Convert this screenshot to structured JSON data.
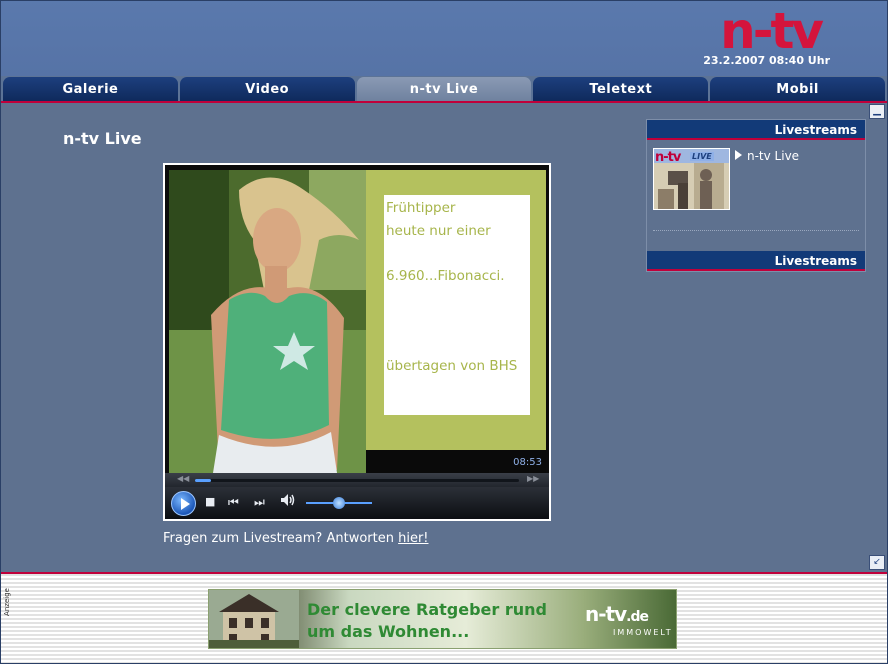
{
  "header": {
    "logo_text": "n-tv",
    "datetime": "23.2.2007 08:40 Uhr"
  },
  "tabs": [
    {
      "label": "Galerie",
      "active": false
    },
    {
      "label": "Video",
      "active": false
    },
    {
      "label": "n-tv Live",
      "active": true
    },
    {
      "label": "Teletext",
      "active": false
    },
    {
      "label": "Mobil",
      "active": false
    }
  ],
  "main": {
    "title": "n-tv Live",
    "video_card_lines": [
      "Frühtipper",
      "heute nur einer",
      "",
      "6.960...Fibonacci.",
      "",
      "",
      "",
      "übertagen von BHS"
    ],
    "player": {
      "time": "08:53",
      "seek_progress": 0.05,
      "volume": 0.5
    },
    "faq_prefix": "Fragen zum Livestream? Antworten ",
    "faq_link": "hier!"
  },
  "sidebar": {
    "header": "Livestreams",
    "footer": "Livestreams",
    "item_label": "n-tv Live",
    "thumb_logo": "n-tv",
    "thumb_badge": "LIVE"
  },
  "footer": {
    "ad_label": "Anzeige",
    "ad_text_line1": "Der clevere Ratgeber rund",
    "ad_text_line2": "um das Wohnen...",
    "ad_logo": "n-tv",
    "ad_logo_tld": ".de",
    "ad_sub": "IMMOWELT"
  },
  "colors": {
    "brand_red": "#d4143c",
    "nav_blue": "#123a78",
    "content_bg": "#5e718f",
    "card_text": "#a7b54b"
  }
}
